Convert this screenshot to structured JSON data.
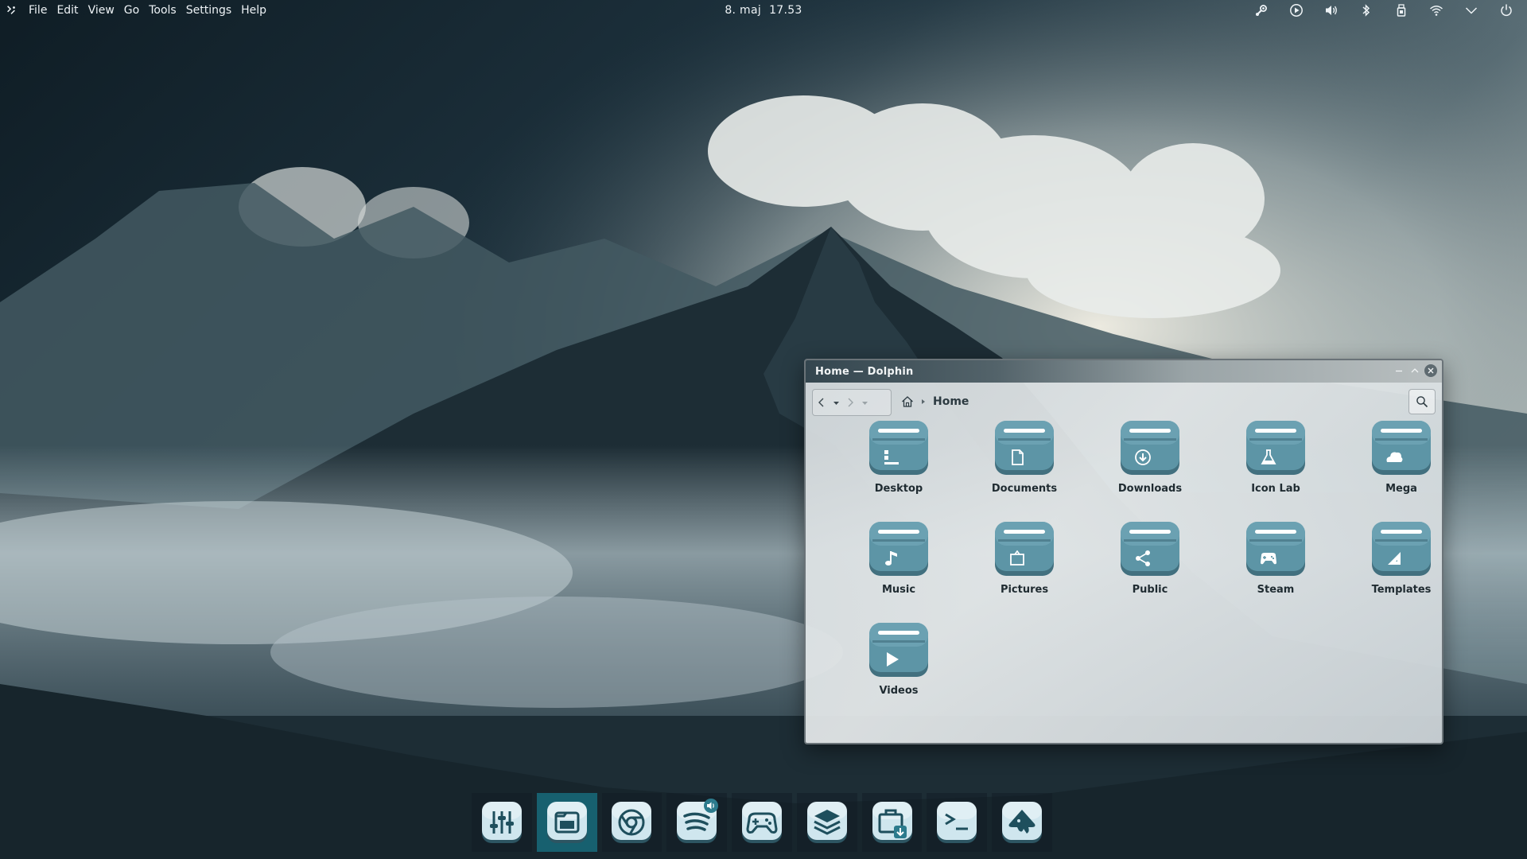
{
  "top_panel": {
    "launcher_icon": "kde-logo-icon",
    "menus": [
      "File",
      "Edit",
      "View",
      "Go",
      "Tools",
      "Settings",
      "Help"
    ],
    "date": "8. maj",
    "time": "17.53",
    "tray": [
      "steam-icon",
      "media-play-icon",
      "volume-icon",
      "bluetooth-icon",
      "usb-drive-icon",
      "wifi-icon",
      "chevron-down-icon",
      "power-icon"
    ]
  },
  "window": {
    "title": "Home — Dolphin",
    "breadcrumb": "Home",
    "items": [
      {
        "label": "Desktop",
        "icon": "desktop-icon"
      },
      {
        "label": "Documents",
        "icon": "document-icon"
      },
      {
        "label": "Downloads",
        "icon": "download-icon"
      },
      {
        "label": "Icon Lab",
        "icon": "flask-icon"
      },
      {
        "label": "Mega",
        "icon": "cloud-icon"
      },
      {
        "label": "Music",
        "icon": "music-note-icon"
      },
      {
        "label": "Pictures",
        "icon": "picture-icon"
      },
      {
        "label": "Public",
        "icon": "share-icon"
      },
      {
        "label": "Steam",
        "icon": "gamepad-icon"
      },
      {
        "label": "Templates",
        "icon": "template-icon"
      },
      {
        "label": "Videos",
        "icon": "play-icon"
      }
    ]
  },
  "dock": {
    "items": [
      {
        "icon": "mixer-icon",
        "active": false
      },
      {
        "icon": "file-manager-icon",
        "active": true
      },
      {
        "icon": "chrome-icon",
        "active": false
      },
      {
        "icon": "spotify-icon",
        "active": false,
        "badge": "volume-badge-icon"
      },
      {
        "icon": "gamepad-icon",
        "active": false
      },
      {
        "icon": "layers-icon",
        "active": false
      },
      {
        "icon": "package-install-icon",
        "active": false
      },
      {
        "icon": "terminal-icon",
        "active": false
      },
      {
        "icon": "inkscape-icon",
        "active": false
      }
    ]
  },
  "colors": {
    "accent": "#17606f",
    "folder_body": "#5d95a6",
    "panel_text": "#eef3f6"
  }
}
